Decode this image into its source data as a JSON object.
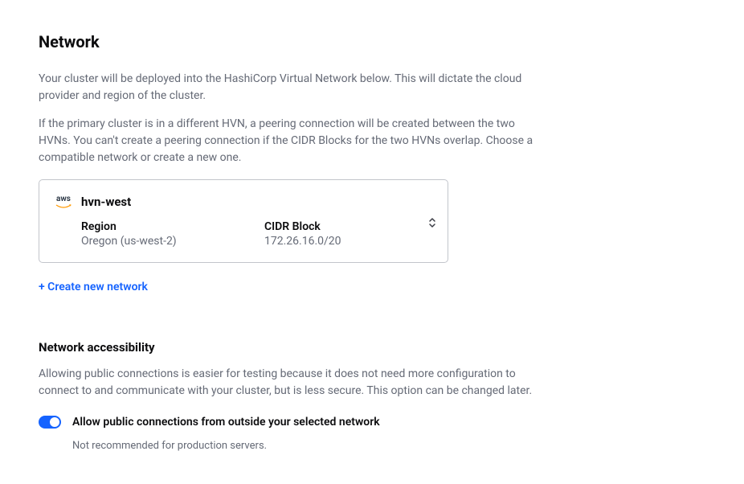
{
  "page": {
    "title": "Network",
    "description1": "Your cluster will be deployed into the HashiCorp Virtual Network below. This will dictate the cloud provider and region of the cluster.",
    "description2": "If the primary cluster is in a different HVN, a peering connection will be created between the two HVNs. You can't create a peering connection if the CIDR Blocks for the two HVNs overlap. Choose a compatible network or create a new one."
  },
  "network": {
    "provider": "aws",
    "name": "hvn-west",
    "region_label": "Region",
    "region_value": "Oregon (us-west-2)",
    "cidr_label": "CIDR Block",
    "cidr_value": "172.26.16.0/20"
  },
  "actions": {
    "create_network": "+ Create new network"
  },
  "accessibility": {
    "title": "Network accessibility",
    "description": "Allowing public connections is easier for testing because it does not need more configuration to connect to and communicate with your cluster, but is less secure. This option can be changed later.",
    "toggle_label": "Allow public connections from outside your selected network",
    "toggle_hint": "Not recommended for production servers.",
    "toggle_on": true
  }
}
